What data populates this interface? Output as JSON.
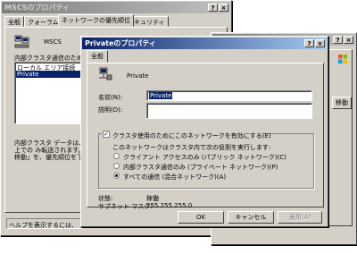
{
  "back_window": {
    "title": "MSCSのプロパティ",
    "tabs": [
      "全般",
      "クォーラム",
      "ネットワークの優先順位",
      "セキュリティ"
    ],
    "cluster_name": "MSCS",
    "list_label": "内部クラスタ通信のために使",
    "list_items": [
      "ローカル エリア接続",
      "Private"
    ],
    "desc_lines": [
      "内部クラスタ データは、利用",
      "上での み転送されます。",
      "移動」を、優先順位を下げ"
    ],
    "help_text": "ヘルプを表示するには、"
  },
  "right_window": {
    "move_label": "移動"
  },
  "front_window": {
    "title": "Privateのプロパティ",
    "tab": "全般",
    "network_name": "Private",
    "name_label": "名前(N):",
    "name_value": "Private",
    "desc_label": "説明(D):",
    "desc_value": "",
    "enable_checkbox_label": "クラスタ使用のためにこのネットワークを有効にする(E)",
    "enable_checked": true,
    "role_intro": "このネットワークはクラスタ内で次の役割を実行します:",
    "roles": [
      {
        "label": "クライアント アクセスのみ (パブリック ネットワーク)(C)",
        "selected": false
      },
      {
        "label": "内部クラスタ通信のみ (プライベート ネットワーク)(P)",
        "selected": false
      },
      {
        "label": "すべての通信 (混合ネットワーク)(A)",
        "selected": true
      }
    ],
    "status_label": "状態:",
    "status_value": "稼働",
    "subnet_label": "サブネット マスク:",
    "subnet_value": "255.255.255.0",
    "ok_label": "OK",
    "cancel_label": "キャンセル",
    "apply_label": "適用(A)"
  }
}
